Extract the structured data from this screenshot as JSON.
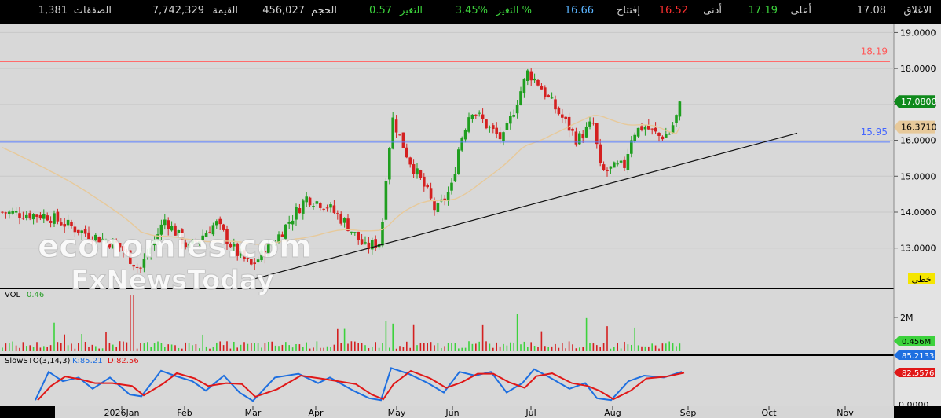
{
  "header": {
    "close": {
      "label": "الاغلاق",
      "value": "17.08"
    },
    "high": {
      "label": "أعلى",
      "value": "17.19"
    },
    "low": {
      "label": "أدنى",
      "value": "16.52"
    },
    "open": {
      "label": "إفتتاح",
      "value": "16.66"
    },
    "change_pct": {
      "label": "التغير %",
      "value": "3.45%"
    },
    "change": {
      "label": "التغير",
      "value": "0.57"
    },
    "volume": {
      "label": "الحجم",
      "value": "456,027"
    },
    "value_traded": {
      "label": "القيمة",
      "value": "7,742,329"
    },
    "trades": {
      "label": "الصفقات",
      "value": "1,381"
    }
  },
  "colors": {
    "up": "#1f9e1f",
    "down": "#d42020",
    "ma": "#e7c99a",
    "resistance": "#ff6b6b",
    "support": "#5a7dff",
    "trend": "#111111",
    "sto_k": "#1e6fe0",
    "sto_d": "#e01818",
    "chart_bg": "#d8d8d8"
  },
  "watermark": {
    "line1": "economies.com",
    "line2": "FxNewsToday"
  },
  "price_panel": {
    "hline_upper_label": "18.19",
    "hline_lower_label": "15.95",
    "last_price_badge": "17.0800",
    "ma_badge": "16.3710",
    "linear_badge": "خطي"
  },
  "volume_panel": {
    "label": "VOL",
    "value": "0.46",
    "badge": "0.456M",
    "tick": "2M"
  },
  "sto_panel": {
    "label": "SlowSTO(3,14,3)",
    "k_text": "K:85.21",
    "d_text": "D:82.56",
    "k_badge": "85.2133",
    "d_badge": "82.5576",
    "zero_label": "0.0000"
  },
  "chart_data": {
    "type": "candlestick",
    "y_axis": {
      "ticks": [
        "19.0000",
        "18.0000",
        "17.0000",
        "16.0000",
        "15.0000",
        "14.0000",
        "13.0000"
      ],
      "ylim": [
        11.9,
        19.25
      ]
    },
    "x_axis": {
      "labels": [
        "2026Jan",
        "Feb",
        "Mar",
        "Apr",
        "May",
        "Jun",
        "Jul",
        "Aug",
        "Sep",
        "Oct",
        "Nov"
      ]
    },
    "horizontal_lines": [
      18.19,
      15.95
    ],
    "trendline": {
      "from": {
        "month": "Mar",
        "price": 12.1
      },
      "to": {
        "month": "Sep",
        "price": 16.2
      }
    },
    "monthly_closes": [
      {
        "month": "Jan",
        "close": 13.8
      },
      {
        "month": "Feb",
        "close": 13.2
      },
      {
        "month": "Mar",
        "close": 12.4
      },
      {
        "month": "Apr",
        "close": 14.3
      },
      {
        "month": "May",
        "close": 15.8
      },
      {
        "month": "Jun",
        "close": 16.9
      },
      {
        "month": "Jul",
        "close": 17.6
      },
      {
        "month": "Aug",
        "close": 15.3
      },
      {
        "month": "Sep",
        "close": 17.08
      }
    ],
    "last_candle": {
      "open": 16.66,
      "high": 17.19,
      "low": 16.52,
      "close": 17.08
    },
    "moving_average_last": 16.371,
    "volume_last_millions": 0.456,
    "stochastic": {
      "k": 85.21,
      "d": 82.56
    }
  }
}
